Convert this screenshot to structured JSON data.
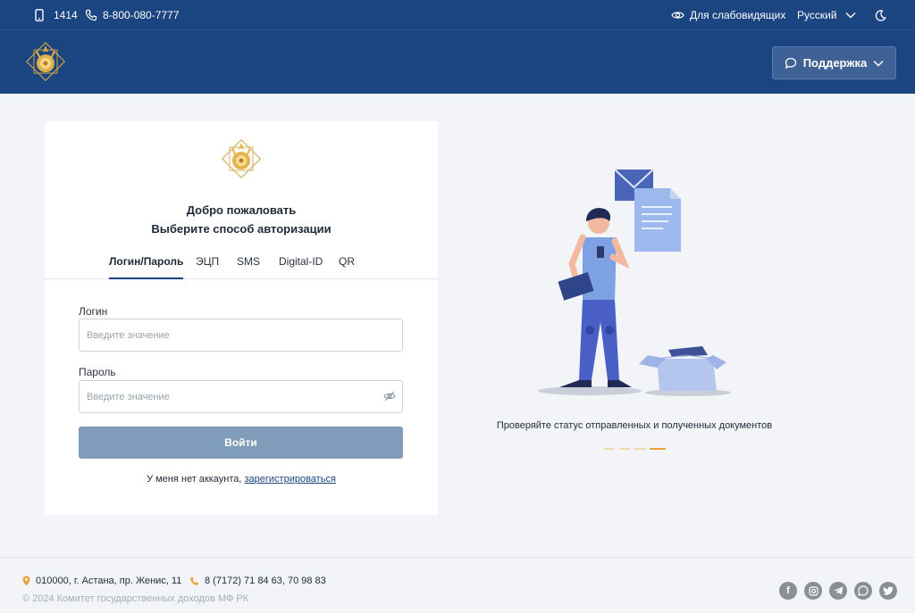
{
  "topbar": {
    "short_number": "1414",
    "phone": "8-800-080-7777",
    "accessibility": "Для слабовидящих",
    "language": "Русский"
  },
  "header": {
    "support_label": "Поддержка"
  },
  "login": {
    "welcome": "Добро пожаловать",
    "choose_method": "Выберите способ авторизации",
    "tabs": [
      "Логин/Пароль",
      "ЭЦП",
      "SMS",
      "Digital-ID",
      "QR"
    ],
    "login_label": "Логин",
    "login_placeholder": "Введите значение",
    "password_label": "Пароль",
    "password_placeholder": "Введите значение",
    "submit_label": "Войти",
    "no_account_text": "У меня нет аккаунта,",
    "register_link": "зарегистрироваться"
  },
  "promo": {
    "caption": "Проверяйте статус отправленных и полученных документов",
    "slide_count": 4,
    "active_slide": 4
  },
  "footer": {
    "address": "010000, г. Астана, пр. Женис, 11",
    "phone": "8 (7172) 71 84 63, 70 98 83",
    "copyright": "© 2024 Комитет государственных доходов МФ РК",
    "socials": [
      "facebook-icon",
      "instagram-icon",
      "telegram-icon",
      "whatsapp-icon",
      "twitter-icon"
    ]
  },
  "colors": {
    "brand_blue": "#1b4580",
    "accent_gold": "#e9a53a",
    "button_disabled": "#7f9cba"
  }
}
